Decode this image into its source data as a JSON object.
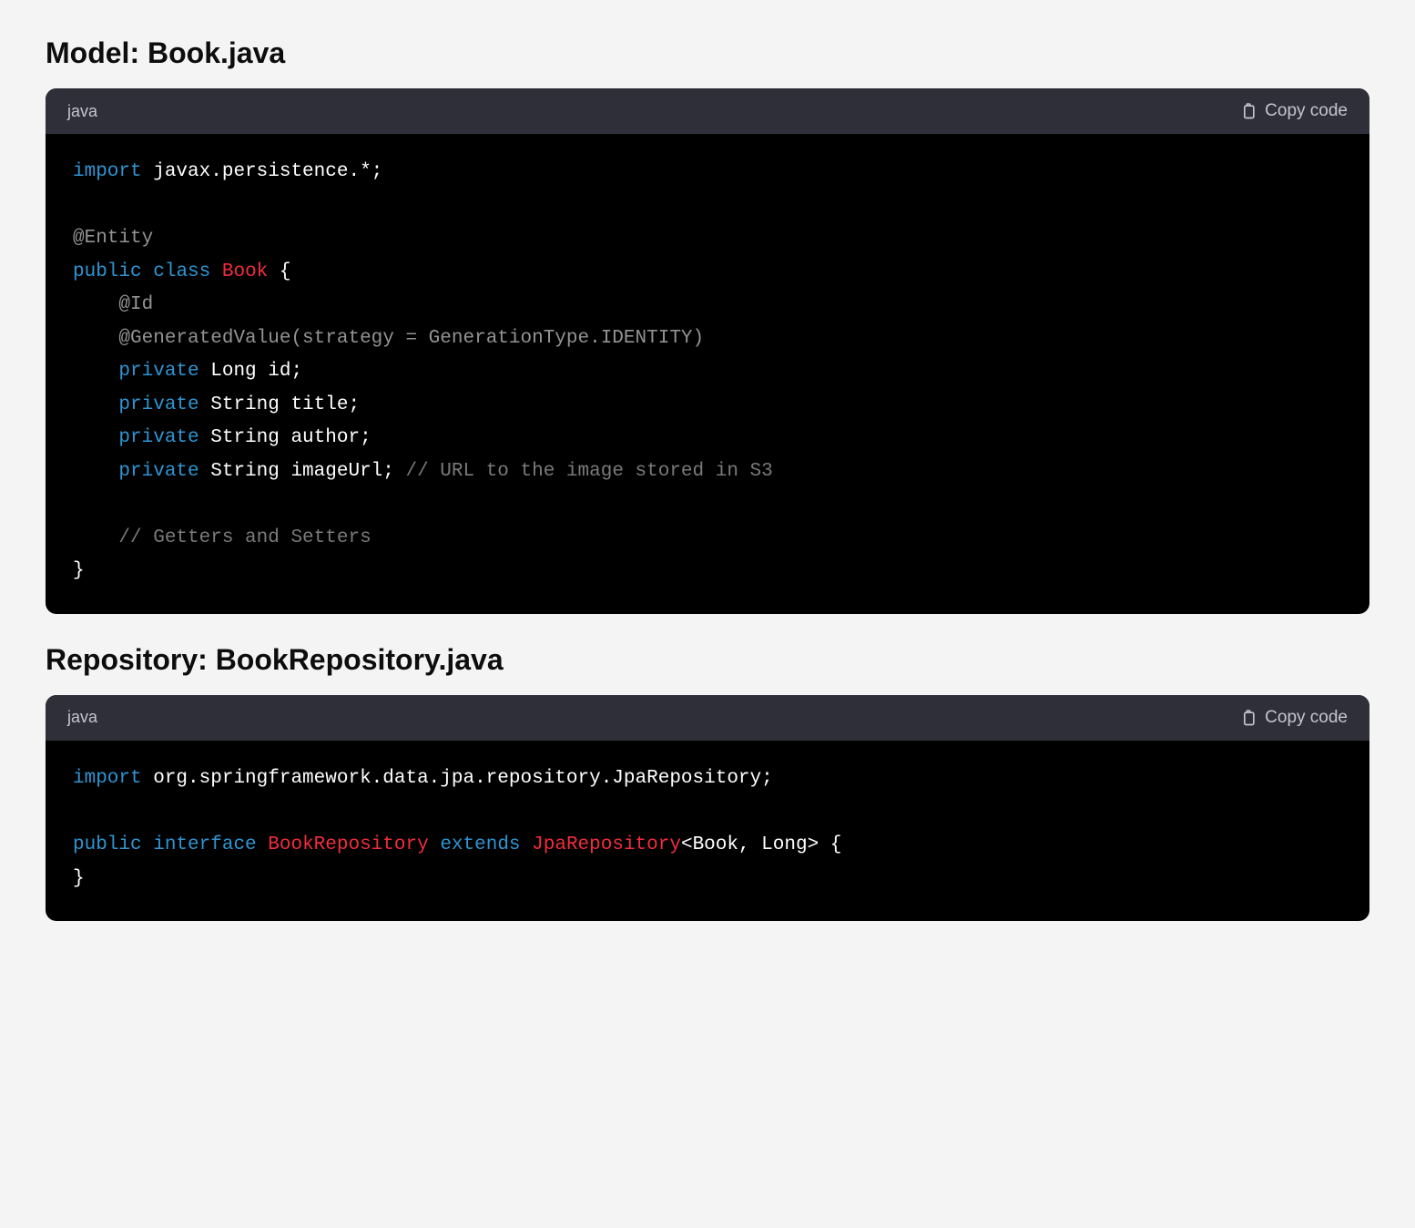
{
  "sections": [
    {
      "heading": "Model: Book.java",
      "lang_label": "java",
      "copy_label": "Copy code",
      "code_tokens": [
        {
          "cls": "kw-import",
          "text": "import"
        },
        {
          "cls": "plain",
          "text": " javax.persistence.*;\n\n"
        },
        {
          "cls": "annotation",
          "text": "@Entity"
        },
        {
          "cls": "plain",
          "text": "\n"
        },
        {
          "cls": "kw-public",
          "text": "public"
        },
        {
          "cls": "plain",
          "text": " "
        },
        {
          "cls": "kw-class",
          "text": "class"
        },
        {
          "cls": "plain",
          "text": " "
        },
        {
          "cls": "type-name",
          "text": "Book"
        },
        {
          "cls": "plain",
          "text": " {\n    "
        },
        {
          "cls": "annotation",
          "text": "@Id"
        },
        {
          "cls": "plain",
          "text": "\n    "
        },
        {
          "cls": "annotation",
          "text": "@GeneratedValue(strategy = GenerationType.IDENTITY)"
        },
        {
          "cls": "plain",
          "text": "\n    "
        },
        {
          "cls": "kw-private",
          "text": "private"
        },
        {
          "cls": "plain",
          "text": " Long id;\n    "
        },
        {
          "cls": "kw-private",
          "text": "private"
        },
        {
          "cls": "plain",
          "text": " String title;\n    "
        },
        {
          "cls": "kw-private",
          "text": "private"
        },
        {
          "cls": "plain",
          "text": " String author;\n    "
        },
        {
          "cls": "kw-private",
          "text": "private"
        },
        {
          "cls": "plain",
          "text": " String imageUrl; "
        },
        {
          "cls": "comment",
          "text": "// URL to the image stored in S3"
        },
        {
          "cls": "plain",
          "text": "\n\n    "
        },
        {
          "cls": "comment",
          "text": "// Getters and Setters"
        },
        {
          "cls": "plain",
          "text": "\n}"
        }
      ]
    },
    {
      "heading": "Repository: BookRepository.java",
      "lang_label": "java",
      "copy_label": "Copy code",
      "code_tokens": [
        {
          "cls": "kw-import",
          "text": "import"
        },
        {
          "cls": "plain",
          "text": " org.springframework.data.jpa.repository.JpaRepository;\n\n"
        },
        {
          "cls": "kw-public",
          "text": "public"
        },
        {
          "cls": "plain",
          "text": " "
        },
        {
          "cls": "kw-interface",
          "text": "interface"
        },
        {
          "cls": "plain",
          "text": " "
        },
        {
          "cls": "type-name",
          "text": "BookRepository"
        },
        {
          "cls": "plain",
          "text": " "
        },
        {
          "cls": "kw-extends",
          "text": "extends"
        },
        {
          "cls": "plain",
          "text": " "
        },
        {
          "cls": "type-name",
          "text": "JpaRepository"
        },
        {
          "cls": "plain",
          "text": "<Book, Long> {\n}"
        }
      ]
    }
  ]
}
